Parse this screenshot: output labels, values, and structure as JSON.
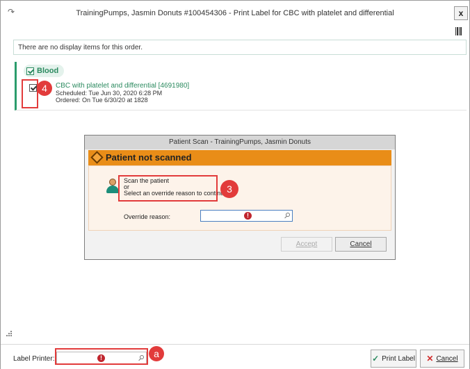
{
  "window": {
    "title": "TrainingPumps, Jasmin Donuts #100454306 - Print Label for CBC with platelet and differential",
    "close_label": "x"
  },
  "message": "There are no display items for this order.",
  "order_group": {
    "label": "Blood",
    "order": {
      "name": "CBC with platelet and differential [4691980]",
      "scheduled": "Scheduled: Tue Jun 30, 2020 6:28 PM",
      "ordered": "Ordered: On Tue 6/30/20 at 1828"
    }
  },
  "dialog": {
    "title": "Patient Scan - TrainingPumps, Jasmin Donuts",
    "header": "Patient not scanned",
    "line1": "Scan the patient",
    "line2": "or",
    "line3": "Select an override reason to continue.",
    "override_label": "Override reason:",
    "override_value": "",
    "accept_label": "Accept",
    "cancel_label": "Cancel"
  },
  "footer": {
    "label_printer_label": "Label Printer:",
    "label_printer_value": "",
    "print_label": "Print Label",
    "cancel_label": "Cancel"
  },
  "annotations": {
    "callout_3": "3",
    "callout_4": "4",
    "callout_a": "a"
  },
  "colors": {
    "accent_green": "#2b8a5f",
    "dialog_header_orange": "#e98d18",
    "error_red": "#c0262e",
    "callout_red": "#e23b3b"
  }
}
